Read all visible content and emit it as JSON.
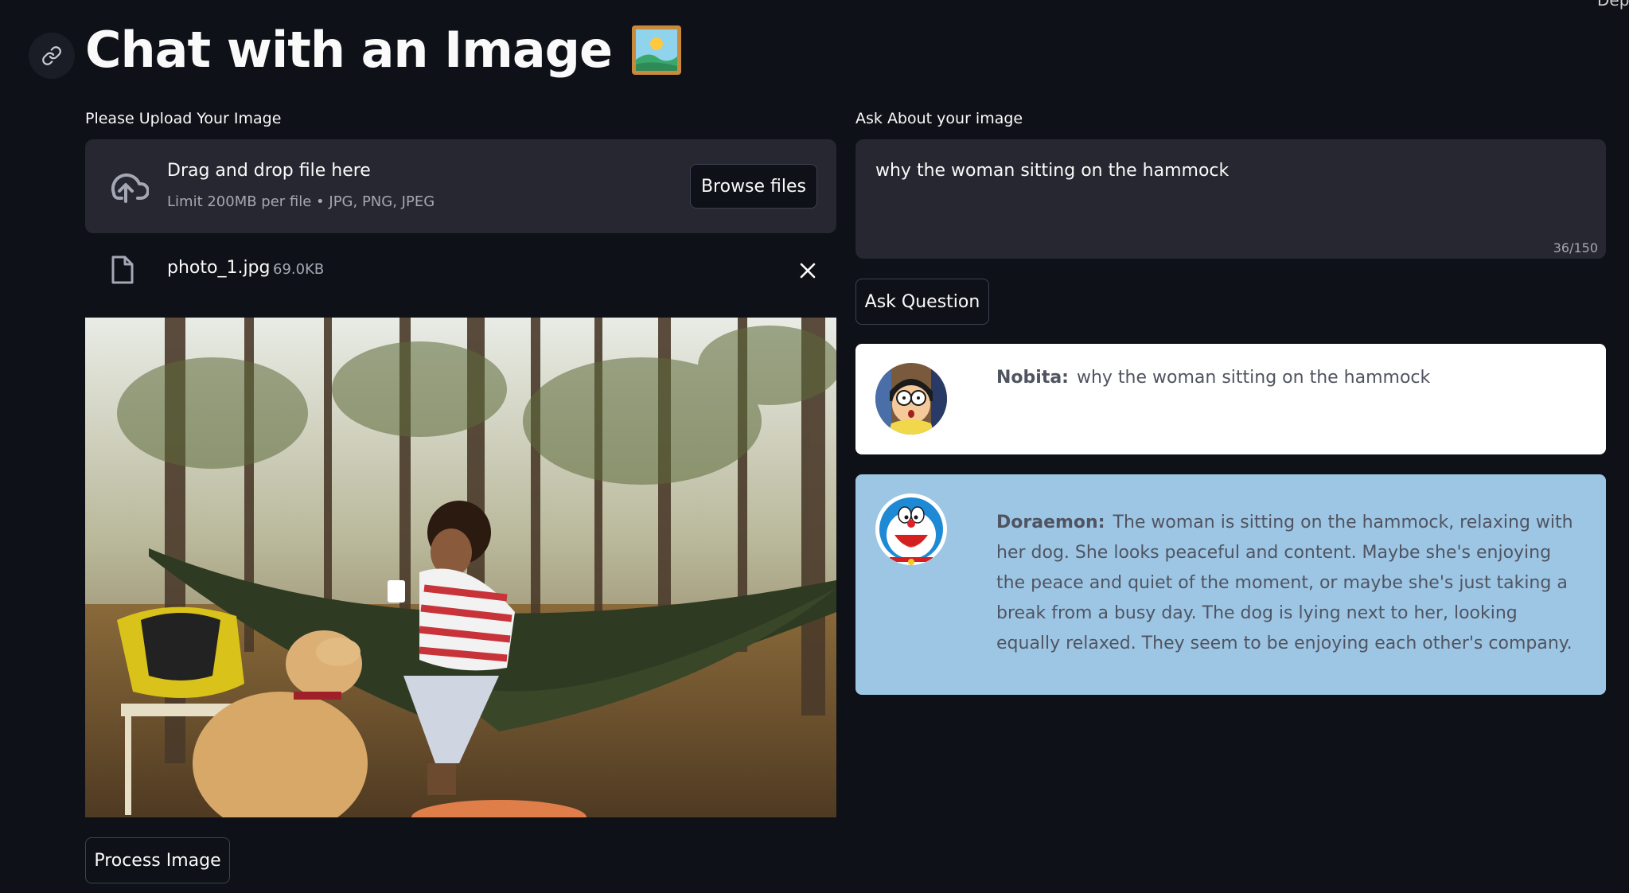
{
  "app": {
    "title": "Chat with an Image",
    "deploy_partial": "Dep"
  },
  "uploader": {
    "label": "Please Upload Your Image",
    "drop_title": "Drag and drop file here",
    "drop_hint": "Limit 200MB per file • JPG, PNG, JPEG",
    "browse_label": "Browse files",
    "file_name": "photo_1.jpg",
    "file_size": "69.0KB",
    "process_label": "Process Image"
  },
  "question": {
    "label": "Ask About your image",
    "value": "why the woman sitting on the hammock",
    "counter": "36/150",
    "ask_label": "Ask Question"
  },
  "chat": [
    {
      "speaker": "Nobita:",
      "text": "why the woman sitting on the hammock"
    },
    {
      "speaker": "Doraemon:",
      "text": "The woman is sitting on the hammock, relaxing with her dog. She looks peaceful and content. Maybe she's enjoying the peace and quiet of the moment, or maybe she's just taking a break from a busy day. The dog is lying next to her, looking equally relaxed. They seem to be enjoying each other's company."
    }
  ],
  "icons": {
    "anchor": "link-icon",
    "upload": "cloud-upload-icon",
    "file": "file-icon",
    "remove": "close-icon",
    "title_emoji": "framed-picture-icon"
  },
  "colors": {
    "background": "#0e1117",
    "input_bg": "#262730",
    "user_bubble": "#ffffff",
    "bot_bubble": "#9dc6e5"
  }
}
